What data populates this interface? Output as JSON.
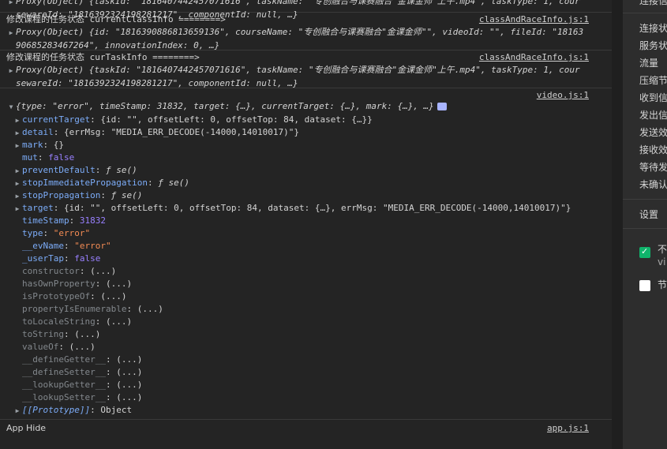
{
  "console": {
    "top_entry": {
      "line1": "Proxy(Object) {taskId: \"1816407442457071616\", taskName: \"专创融合与课赛融合\"金课金师\"上午.mp4\", taskType: 1, cour",
      "line2": "sewareId: \"1816392324198281217\", componentId: null, …}"
    },
    "class_entry": {
      "label": "修改课程的任务状态",
      "var": "currentClassInfo ========>",
      "source": "classAndRaceInfo.js:1",
      "line1": "Proxy(Object) {id: \"1816390886813659136\", courseName: \"专创融合与课赛融合\"金课金师\"\", videoId: \"\", fileId: \"18163",
      "line2": "90685283467264\", innovationIndex: 0, …}"
    },
    "task_entry": {
      "label": "修改课程的任务状态",
      "var": "curTaskInfo  ========>",
      "source": "classAndRaceInfo.js:1",
      "line1": "Proxy(Object) {taskId: \"1816407442457071616\", taskName: \"专创融合与课赛融合\"金课金师\"上午.mp4\", taskType: 1, cour",
      "line2": "sewareId: \"1816392324198281217\", componentId: null, …}"
    },
    "video_entry": {
      "source": "video.js:1",
      "summary": "{type: \"error\", timeStamp: 31832, target: {…}, currentTarget: {…}, mark: {…}, …}",
      "rows": [
        {
          "key": "currentTarget",
          "value": "{id: \"\", offsetLeft: 0, offsetTop: 84, dataset: {…}}",
          "expandable": true,
          "dim": false
        },
        {
          "key": "detail",
          "value": "{errMsg: \"MEDIA_ERR_DECODE(-14000,14010017)\"}",
          "expandable": true,
          "dim": false
        },
        {
          "key": "mark",
          "value": "{}",
          "expandable": true,
          "dim": false
        },
        {
          "key": "mut",
          "value": "false",
          "expandable": false,
          "dim": false
        },
        {
          "key": "preventDefault",
          "value": "ƒ se()",
          "expandable": true,
          "dim": false
        },
        {
          "key": "stopImmediatePropagation",
          "value": "ƒ se()",
          "expandable": true,
          "dim": false
        },
        {
          "key": "stopPropagation",
          "value": "ƒ se()",
          "expandable": true,
          "dim": false
        },
        {
          "key": "target",
          "value": "{id: \"\", offsetLeft: 0, offsetTop: 84, dataset: {…}, errMsg: \"MEDIA_ERR_DECODE(-14000,14010017)\"}",
          "expandable": true,
          "dim": false
        },
        {
          "key": "timeStamp",
          "value": "31832",
          "expandable": false,
          "dim": false
        },
        {
          "key": "type",
          "value": "\"error\"",
          "expandable": false,
          "dim": false
        },
        {
          "key": "__evName",
          "value": "\"error\"",
          "expandable": false,
          "dim": false
        },
        {
          "key": "_userTap",
          "value": "false",
          "expandable": false,
          "dim": false
        },
        {
          "key": "constructor",
          "value": "(...)",
          "expandable": false,
          "dim": true
        },
        {
          "key": "hasOwnProperty",
          "value": "(...)",
          "expandable": false,
          "dim": true
        },
        {
          "key": "isPrototypeOf",
          "value": "(...)",
          "expandable": false,
          "dim": true
        },
        {
          "key": "propertyIsEnumerable",
          "value": "(...)",
          "expandable": false,
          "dim": true
        },
        {
          "key": "toLocaleString",
          "value": "(...)",
          "expandable": false,
          "dim": true
        },
        {
          "key": "toString",
          "value": "(...)",
          "expandable": false,
          "dim": true
        },
        {
          "key": "valueOf",
          "value": "(...)",
          "expandable": false,
          "dim": true
        },
        {
          "key": "__defineGetter__",
          "value": "(...)",
          "expandable": false,
          "dim": true
        },
        {
          "key": "__defineSetter__",
          "value": "(...)",
          "expandable": false,
          "dim": true
        },
        {
          "key": "__lookupGetter__",
          "value": "(...)",
          "expandable": false,
          "dim": true
        },
        {
          "key": "__lookupSetter__",
          "value": "(...)",
          "expandable": false,
          "dim": true
        },
        {
          "key": "[[Prototype]]",
          "value": "Object",
          "expandable": true,
          "dim": false
        }
      ]
    },
    "app_entry": {
      "text": "App Hide",
      "source": "app.js:1"
    }
  },
  "sidebar": {
    "items": [
      "连接状",
      "服务状",
      "流量",
      "压缩节",
      "收到信",
      "发出信",
      "发送效",
      "接收效",
      "等待发",
      "未确认"
    ],
    "top_item": "连接信",
    "settings_label": "设置",
    "checkbox1_label": "不",
    "checkbox1_sub": "vi",
    "checkbox2_label": "节"
  },
  "colors": {
    "string": "#f28b54",
    "number": "#9980ff",
    "key": "#7cacf8",
    "checkbox_on": "#0fb36b"
  }
}
